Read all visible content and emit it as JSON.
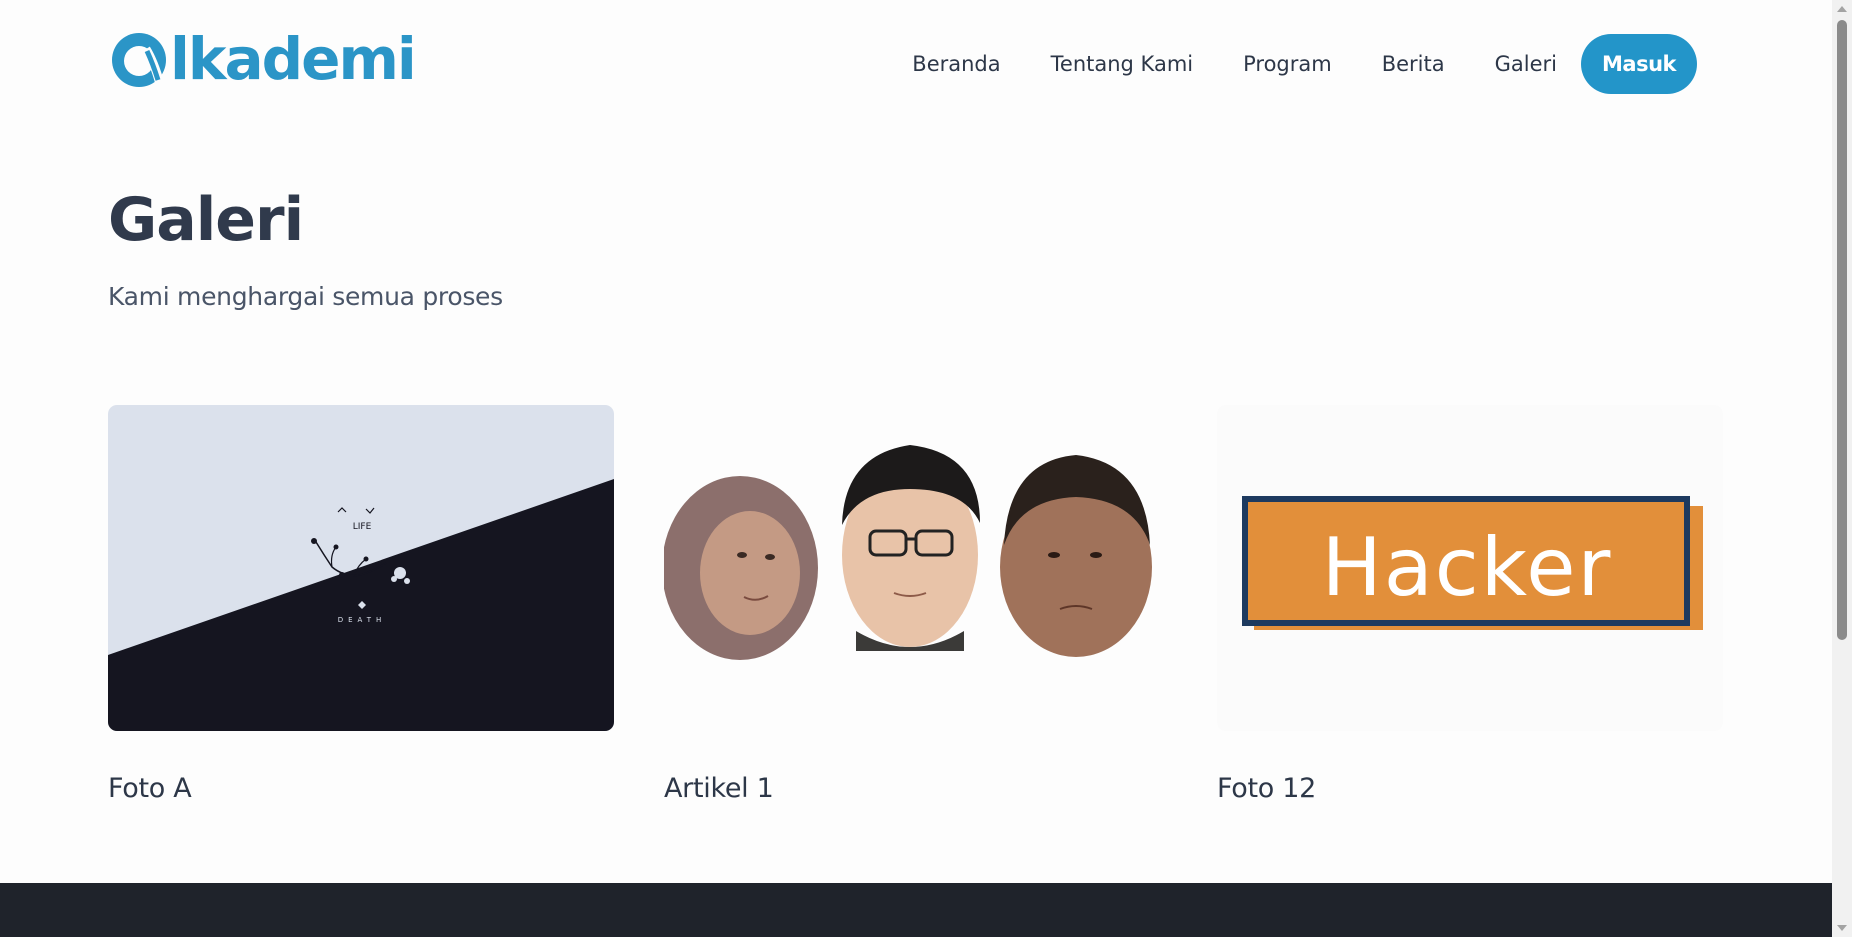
{
  "brand": {
    "logo_text": "lkademi",
    "logo_mark": "α",
    "color": "#2b95c7"
  },
  "nav": {
    "items": [
      {
        "label": "Beranda"
      },
      {
        "label": "Tentang Kami"
      },
      {
        "label": "Program"
      },
      {
        "label": "Berita"
      },
      {
        "label": "Galeri"
      }
    ],
    "login_label": "Masuk",
    "login_color": "#2395c9"
  },
  "hero": {
    "title": "Galeri",
    "subtitle": "Kami menghargai semua proses"
  },
  "gallery": {
    "items": [
      {
        "caption": "Foto A",
        "image_text": [
          "LIFE",
          "DEATH"
        ]
      },
      {
        "caption": "Artikel 1"
      },
      {
        "caption": "Foto 12",
        "image_text": "Hacker"
      }
    ]
  },
  "colors": {
    "footer": "#1f232b",
    "hacker_orange": "#e28f3a",
    "hacker_navy": "#1d3a5f"
  }
}
